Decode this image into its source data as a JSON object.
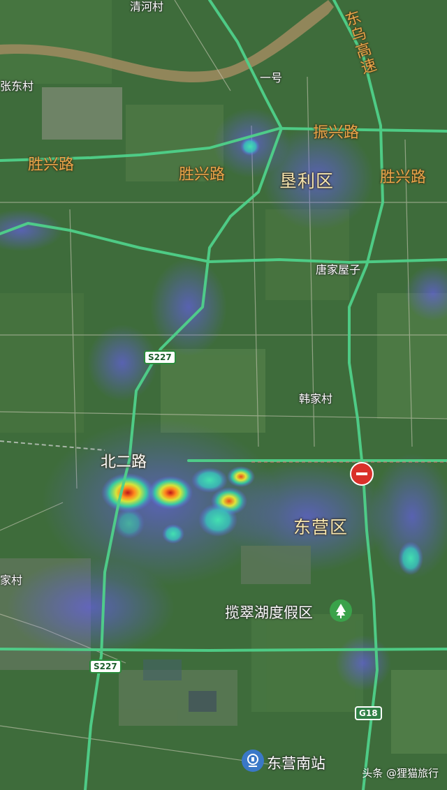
{
  "labels": {
    "top_village": "清河村",
    "zhangdong_village": "张东村",
    "yihao": "一号",
    "left_village": "家村",
    "tangjia": "唐家屋子",
    "hanjia": "韩家村"
  },
  "roads": {
    "shengxing_left": "胜兴路",
    "shengxing_mid": "胜兴路",
    "shengxing_right": "胜兴路",
    "zhenxing": "振兴路",
    "beier": "北二路",
    "dongwu_expressway": "东乌高速",
    "s227_top": "S227",
    "s227_bottom": "S227",
    "g18": "G18"
  },
  "districts": {
    "kenli": "垦利区",
    "dongying": "东营区"
  },
  "pois": {
    "lancui_lake": "揽翠湖度假区",
    "south_station": "东营南站"
  },
  "watermark": "头条 @狸猫旅行",
  "icons": [
    "no-entry-icon",
    "tree-park-icon",
    "train-station-icon"
  ],
  "colors": {
    "road": "#4fd18a",
    "heat_low": "#6a5cff",
    "heat_mid": "#32d7a0",
    "heat_high": "#e33a1f"
  }
}
